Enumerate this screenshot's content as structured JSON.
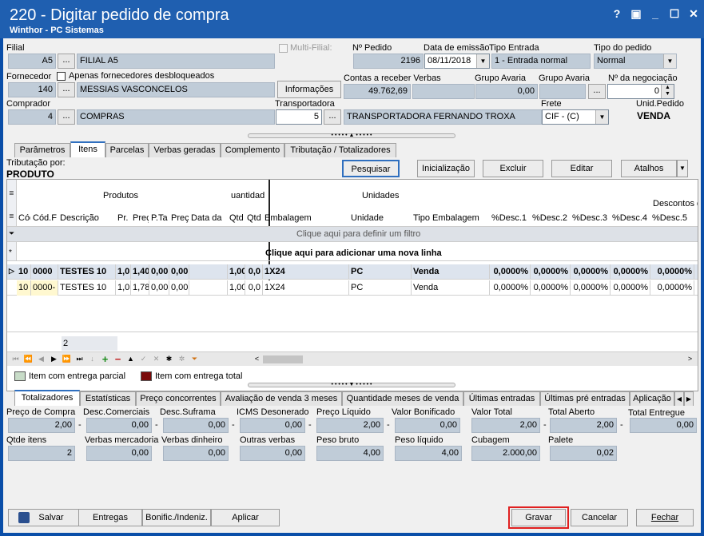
{
  "window": {
    "title": "220 - Digitar pedido de compra",
    "subtitle": "Winthor - PC Sistemas",
    "help": "?",
    "min": "_",
    "max": "☐",
    "close": "✕",
    "restore": "▣"
  },
  "header": {
    "filial_label": "Filial",
    "filial_code": "A5",
    "filial_name": "FILIAL A5",
    "multi_filial_label": "Multi-Filial:",
    "num_pedido_label": "Nº Pedido",
    "num_pedido": "2196",
    "data_emissao_label": "Data de emissão",
    "data_emissao": "08/11/2018",
    "tipo_entrada_label": "Tipo Entrada",
    "tipo_entrada": "1 - Entrada normal",
    "tipo_pedido_label": "Tipo do pedido",
    "tipo_pedido": "Normal",
    "fornecedor_label": "Fornecedor",
    "apenas_label": "Apenas fornecedores desbloqueados",
    "fornecedor_code": "140",
    "fornecedor_name": "MESSIAS VASCONCELOS",
    "informacoes": "Informações",
    "contas_label": "Contas a receber Verbas",
    "contas_value": "49.762,69",
    "grupo_avaria1_label": "Grupo Avaria",
    "grupo_avaria1_value": "0,00",
    "grupo_avaria2_label": "Grupo Avaria",
    "negociacao_label": "Nº da negociação",
    "negociacao_value": "0",
    "comprador_label": "Comprador",
    "comprador_code": "4",
    "comprador_name": "COMPRAS",
    "transp_label": "Transportadora",
    "transp_code": "5",
    "transp_name": "TRANSPORTADORA FERNANDO TROXA",
    "frete_label": "Frete",
    "frete_value": "CIF - (C)",
    "unid_label": "Unid.Pedido",
    "unid_value": "VENDA"
  },
  "tabs_top": [
    "Parâmetros",
    "Itens",
    "Parcelas",
    "Verbas geradas",
    "Complemento",
    "Tributação / Totalizadores"
  ],
  "toolbar": {
    "trib_label": "Tributação por:",
    "trib_value": "PRODUTO",
    "pesquisar": "Pesquisar",
    "inicializacao": "Inicialização",
    "excluir": "Excluir",
    "editar": "Editar",
    "atalhos": "Atalhos"
  },
  "grid": {
    "group_produtos": "Produtos",
    "group_qtd": "uantidad",
    "group_unidades": "Unidades",
    "group_descontos": "Descontos d",
    "cols": [
      "Cód",
      "Cód.F",
      "Descrição",
      "Pr.",
      "Preç",
      "P.Ta",
      "Preç",
      "Data da",
      "Qtd",
      "Qtd",
      "Embalagem",
      "Unidade",
      "Tipo Embalagem",
      "%Desc.1",
      "%Desc.2",
      "%Desc.3",
      "%Desc.4",
      "%Desc.5"
    ],
    "filter": "Clique aqui para definir um filtro",
    "add_line": "Clique aqui para adicionar uma nova linha",
    "rows": [
      [
        "10",
        "0000",
        "TESTES 10",
        "1,0",
        "1,40",
        "0,00",
        "0,00",
        "",
        "1,00",
        "0,0",
        "1X24",
        "PC",
        "Venda",
        "0,0000%",
        "0,0000%",
        "0,0000%",
        "0,0000%",
        "0,0000%"
      ],
      [
        "10",
        "0000-",
        "TESTES 10",
        "1,0",
        "1,78",
        "0,00",
        "0,00",
        "",
        "1,00",
        "0,0",
        "1X24",
        "PC",
        "Venda",
        "0,0000%",
        "0,0000%",
        "0,0000%",
        "0,0000%",
        "0,0000%"
      ]
    ],
    "footer_count": "2"
  },
  "legend": {
    "parcial": "Item com entrega parcial",
    "total": "Item com entrega total",
    "parcial_color": "#c8dcc8",
    "total_color": "#7a0a0a"
  },
  "tabs_bottom": [
    "Totalizadores",
    "Estatísticas",
    "Preço concorrentes",
    "Avaliação de venda 3 meses",
    "Quantidade meses de venda",
    "Últimas entradas",
    "Últimas pré entradas",
    "Aplicação"
  ],
  "totals": {
    "preco_compra_l": "Preço de Compra",
    "preco_compra": "2,00",
    "desc_com_l": "Desc.Comerciais",
    "desc_com": "0,00",
    "desc_suf_l": "Desc.Suframa",
    "desc_suf": "0,00",
    "icms_l": "ICMS Desonerado",
    "icms": "0,00",
    "preco_liq_l": "Preço Líquido",
    "preco_liq": "2,00",
    "valor_bon_l": "Valor Bonificado",
    "valor_bon": "0,00",
    "valor_total_l": "Valor Total",
    "valor_total": "2,00",
    "total_aberto_l": "Total Aberto",
    "total_aberto": "2,00",
    "total_entregue_l": "Total Entregue",
    "total_entregue": "0,00",
    "qtde_l": "Qtde itens",
    "qtde": "2",
    "verbas_merc_l": "Verbas mercadoria",
    "verbas_merc": "0,00",
    "verbas_din_l": "Verbas dinheiro",
    "verbas_din": "0,00",
    "outras_l": "Outras verbas",
    "outras": "0,00",
    "peso_bruto_l": "Peso bruto",
    "peso_bruto": "4,00",
    "peso_liq_l": "Peso líquido",
    "peso_liq": "4,00",
    "cubagem_l": "Cubagem",
    "cubagem": "2.000,00",
    "palete_l": "Palete",
    "palete": "0,02",
    "dash": "-"
  },
  "bottom": {
    "salvar": "Salvar",
    "entregas": "Entregas",
    "bonific": "Bonific./Indeniz.",
    "aplicar": "Aplicar",
    "gravar": "Gravar",
    "cancelar": "Cancelar",
    "fechar": "Fechar"
  }
}
